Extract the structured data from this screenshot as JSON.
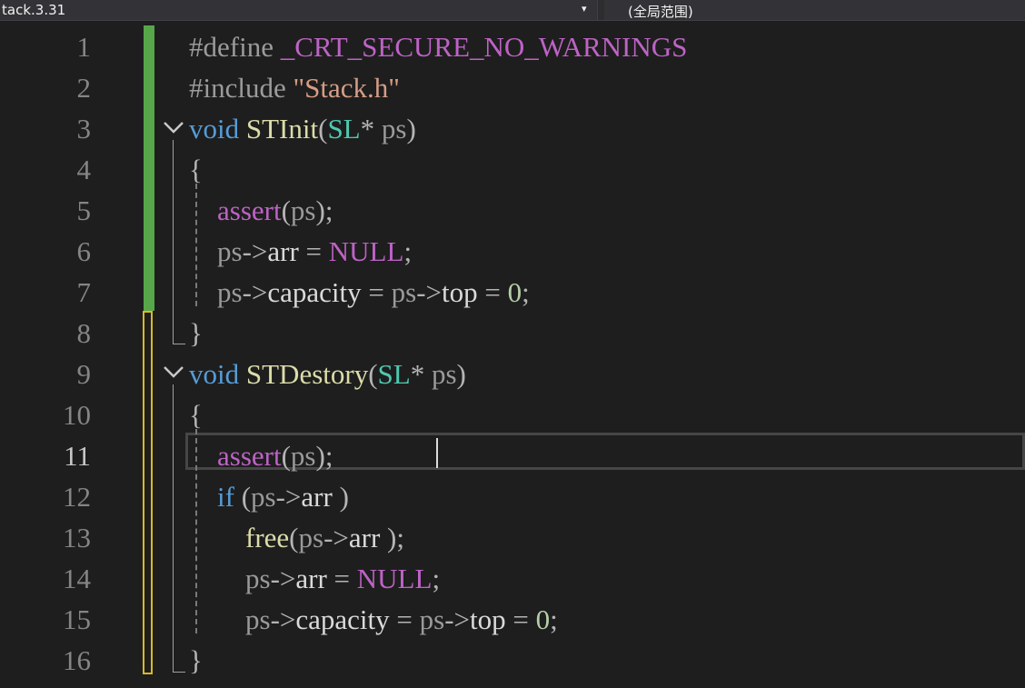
{
  "navbar": {
    "project_label": "tack.3.31",
    "dropdown_arrow": "▾",
    "scope_label": "(全局范围)"
  },
  "editor": {
    "active_line": 11,
    "lines": [
      {
        "num": "1",
        "tokens": [
          {
            "t": "#define ",
            "c": "t-pre"
          },
          {
            "t": "_CRT_SECURE_NO_WARNINGS",
            "c": "t-macro"
          }
        ]
      },
      {
        "num": "2",
        "tokens": [
          {
            "t": "#include ",
            "c": "t-pre"
          },
          {
            "t": "\"Stack.h\"",
            "c": "t-str"
          }
        ]
      },
      {
        "num": "3",
        "tokens": [
          {
            "t": "void",
            "c": "t-kw"
          },
          {
            "t": " ",
            "c": ""
          },
          {
            "t": "STInit",
            "c": "t-fn"
          },
          {
            "t": "(",
            "c": "t-punc"
          },
          {
            "t": "SL",
            "c": "t-type"
          },
          {
            "t": "* ",
            "c": "t-op"
          },
          {
            "t": "ps",
            "c": "t-param"
          },
          {
            "t": ")",
            "c": "t-punc"
          }
        ]
      },
      {
        "num": "4",
        "tokens": [
          {
            "t": "{",
            "c": "t-punc"
          }
        ]
      },
      {
        "num": "5",
        "tokens": [
          {
            "t": "    ",
            "c": ""
          },
          {
            "t": "assert",
            "c": "t-macro"
          },
          {
            "t": "(",
            "c": "t-punc"
          },
          {
            "t": "ps",
            "c": "t-param"
          },
          {
            "t": ");",
            "c": "t-punc"
          }
        ]
      },
      {
        "num": "6",
        "tokens": [
          {
            "t": "    ",
            "c": ""
          },
          {
            "t": "ps",
            "c": "t-param"
          },
          {
            "t": "->",
            "c": "t-op"
          },
          {
            "t": "arr",
            "c": "t-field"
          },
          {
            "t": " = ",
            "c": "t-op"
          },
          {
            "t": "NULL",
            "c": "t-macro"
          },
          {
            "t": ";",
            "c": "t-punc"
          }
        ]
      },
      {
        "num": "7",
        "tokens": [
          {
            "t": "    ",
            "c": ""
          },
          {
            "t": "ps",
            "c": "t-param"
          },
          {
            "t": "->",
            "c": "t-op"
          },
          {
            "t": "capacity",
            "c": "t-field"
          },
          {
            "t": " = ",
            "c": "t-op"
          },
          {
            "t": "ps",
            "c": "t-param"
          },
          {
            "t": "->",
            "c": "t-op"
          },
          {
            "t": "top",
            "c": "t-field"
          },
          {
            "t": " = ",
            "c": "t-op"
          },
          {
            "t": "0",
            "c": "t-num"
          },
          {
            "t": ";",
            "c": "t-punc"
          }
        ]
      },
      {
        "num": "8",
        "tokens": [
          {
            "t": "}",
            "c": "t-punc"
          }
        ]
      },
      {
        "num": "9",
        "tokens": [
          {
            "t": "void",
            "c": "t-kw"
          },
          {
            "t": " ",
            "c": ""
          },
          {
            "t": "STDestory",
            "c": "t-fn"
          },
          {
            "t": "(",
            "c": "t-punc"
          },
          {
            "t": "SL",
            "c": "t-type"
          },
          {
            "t": "* ",
            "c": "t-op"
          },
          {
            "t": "ps",
            "c": "t-param"
          },
          {
            "t": ")",
            "c": "t-punc"
          }
        ]
      },
      {
        "num": "10",
        "tokens": [
          {
            "t": "{",
            "c": "t-punc"
          }
        ]
      },
      {
        "num": "11",
        "tokens": [
          {
            "t": "    ",
            "c": ""
          },
          {
            "t": "assert",
            "c": "t-macro"
          },
          {
            "t": "(",
            "c": "t-punc"
          },
          {
            "t": "ps",
            "c": "t-param"
          },
          {
            "t": ");",
            "c": "t-punc"
          }
        ]
      },
      {
        "num": "12",
        "tokens": [
          {
            "t": "    ",
            "c": ""
          },
          {
            "t": "if",
            "c": "t-kw"
          },
          {
            "t": " (",
            "c": "t-punc"
          },
          {
            "t": "ps",
            "c": "t-param"
          },
          {
            "t": "->",
            "c": "t-op"
          },
          {
            "t": "arr",
            "c": "t-field"
          },
          {
            "t": " )",
            "c": "t-punc"
          }
        ]
      },
      {
        "num": "13",
        "tokens": [
          {
            "t": "        ",
            "c": ""
          },
          {
            "t": "free",
            "c": "t-fn"
          },
          {
            "t": "(",
            "c": "t-punc"
          },
          {
            "t": "ps",
            "c": "t-param"
          },
          {
            "t": "->",
            "c": "t-op"
          },
          {
            "t": "arr",
            "c": "t-field"
          },
          {
            "t": " );",
            "c": "t-punc"
          }
        ]
      },
      {
        "num": "14",
        "tokens": [
          {
            "t": "        ",
            "c": ""
          },
          {
            "t": "ps",
            "c": "t-param"
          },
          {
            "t": "->",
            "c": "t-op"
          },
          {
            "t": "arr",
            "c": "t-field"
          },
          {
            "t": " = ",
            "c": "t-op"
          },
          {
            "t": "NULL",
            "c": "t-macro"
          },
          {
            "t": ";",
            "c": "t-punc"
          }
        ]
      },
      {
        "num": "15",
        "tokens": [
          {
            "t": "        ",
            "c": ""
          },
          {
            "t": "ps",
            "c": "t-param"
          },
          {
            "t": "->",
            "c": "t-op"
          },
          {
            "t": "capacity",
            "c": "t-field"
          },
          {
            "t": " = ",
            "c": "t-op"
          },
          {
            "t": "ps",
            "c": "t-param"
          },
          {
            "t": "->",
            "c": "t-op"
          },
          {
            "t": "top",
            "c": "t-field"
          },
          {
            "t": " = ",
            "c": "t-op"
          },
          {
            "t": "0",
            "c": "t-num"
          },
          {
            "t": ";",
            "c": "t-punc"
          }
        ]
      },
      {
        "num": "16",
        "tokens": [
          {
            "t": "}",
            "c": "t-punc"
          }
        ]
      }
    ]
  }
}
